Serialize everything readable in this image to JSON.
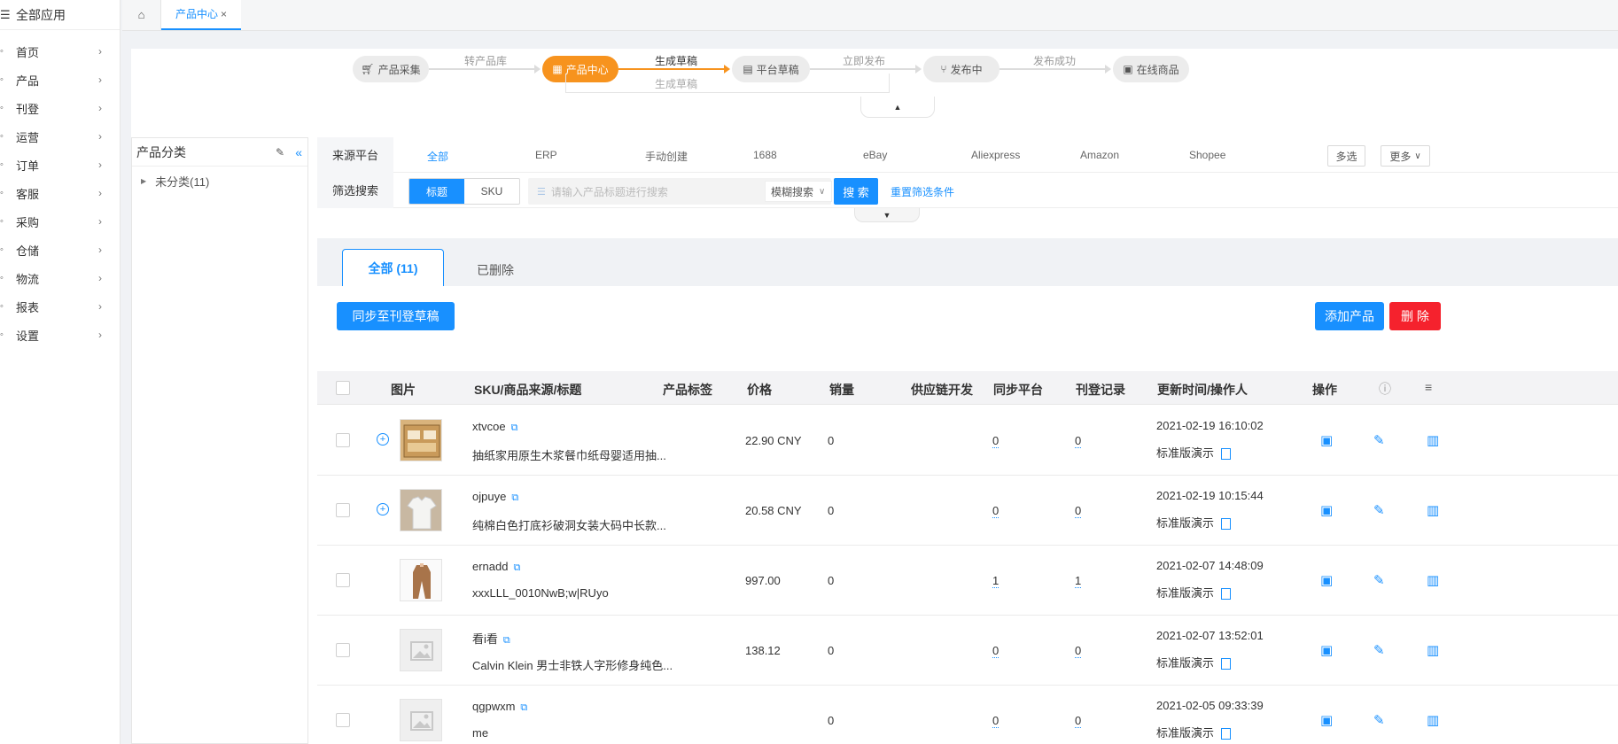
{
  "sidebar": {
    "all_apps": "全部应用",
    "items": [
      {
        "label": "首页",
        "icon": "home-icon"
      },
      {
        "label": "产品",
        "icon": "product-icon"
      },
      {
        "label": "刊登",
        "icon": "listing-icon"
      },
      {
        "label": "运营",
        "icon": "operation-icon"
      },
      {
        "label": "订单",
        "icon": "order-icon"
      },
      {
        "label": "客服",
        "icon": "service-icon"
      },
      {
        "label": "采购",
        "icon": "purchase-icon"
      },
      {
        "label": "仓储",
        "icon": "warehouse-icon"
      },
      {
        "label": "物流",
        "icon": "logistics-icon"
      },
      {
        "label": "报表",
        "icon": "report-icon"
      },
      {
        "label": "设置",
        "icon": "settings-icon"
      }
    ]
  },
  "topbar": {
    "tab_label": "产品中心",
    "close": "×"
  },
  "flow": {
    "steps": [
      "产品采集",
      "产品中心",
      "平台草稿",
      "发布中",
      "在线商品"
    ],
    "transitions": [
      "转产品库",
      "生成草稿",
      "立即发布",
      "发布成功"
    ],
    "sub_label": "生成草稿"
  },
  "category": {
    "title": "产品分类",
    "items": [
      {
        "label": "未分类(11)"
      }
    ]
  },
  "filters": {
    "source_label": "来源平台",
    "sources": [
      "全部",
      "ERP",
      "手动创建",
      "1688",
      "eBay",
      "Aliexpress",
      "Amazon",
      "Shopee"
    ],
    "multi": "多选",
    "more": "更多",
    "search_label": "筛选搜索",
    "mode_title": "标题",
    "mode_sku": "SKU",
    "placeholder": "请输入产品标题进行搜索",
    "fuzzy": "模糊搜索",
    "search_btn": "搜 索",
    "reset": "重置筛选条件"
  },
  "tabs": {
    "all": "全部 (11)",
    "deleted": "已删除"
  },
  "toolbar": {
    "sync": "同步至刊登草稿",
    "add": "添加产品",
    "delete": "删 除"
  },
  "table": {
    "headers": [
      "图片",
      "SKU/商品来源/标题",
      "产品标签",
      "价格",
      "销量",
      "供应链开发",
      "同步平台",
      "刊登记录",
      "更新时间/操作人",
      "操作"
    ],
    "rows": [
      {
        "sku": "xtvcoe",
        "title": "抽纸家用原生木浆餐巾纸母婴适用抽...",
        "price": "22.90 CNY",
        "sales": "0",
        "sync": "0",
        "records": "0",
        "time": "2021-02-19 16:10:02",
        "operator": "标准版演示",
        "thumb": "box",
        "plus": true
      },
      {
        "sku": "ojpuye",
        "title": "纯棉白色打底衫破洞女装大码中长款...",
        "price": "20.58 CNY",
        "sales": "0",
        "sync": "0",
        "records": "0",
        "time": "2021-02-19 10:15:44",
        "operator": "标准版演示",
        "thumb": "shirt",
        "plus": true
      },
      {
        "sku": "ernadd",
        "title": "xxxLLL_0010NwB;w|RUyo",
        "price": "997.00",
        "sales": "0",
        "sync": "1",
        "records": "1",
        "time": "2021-02-07 14:48:09",
        "operator": "标准版演示",
        "thumb": "coat",
        "plus": false
      },
      {
        "sku": "看i看",
        "title": "Calvin Klein 男士非铁人字形修身纯色...",
        "price": "138.12",
        "sales": "0",
        "sync": "0",
        "records": "0",
        "time": "2021-02-07 13:52:01",
        "operator": "标准版演示",
        "thumb": "placeholder",
        "plus": false
      },
      {
        "sku": "qgpwxm",
        "title": "me",
        "price": "",
        "sales": "0",
        "sync": "0",
        "records": "0",
        "time": "2021-02-05 09:33:39",
        "operator": "标准版演示",
        "thumb": "placeholder",
        "plus": false
      }
    ]
  },
  "colors": {
    "primary": "#1890ff",
    "orange": "#f7931e",
    "danger": "#f5222d"
  }
}
